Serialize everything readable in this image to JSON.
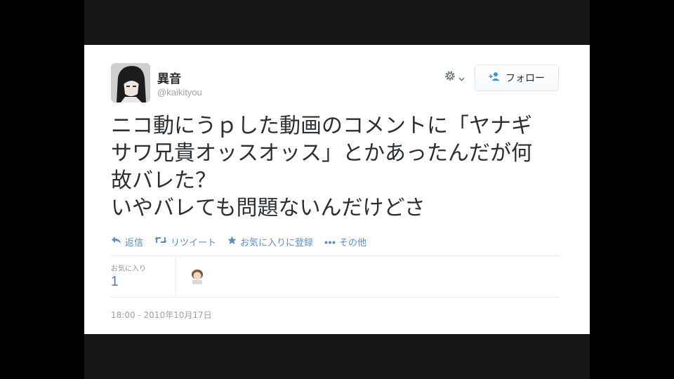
{
  "tweet": {
    "display_name": "異音",
    "handle": "@kaikityou",
    "follow_label": "フォロー",
    "text": "ニコ動にうｐした動画のコメントに「ヤナギ\nサワ兄貴オッスオッス」とかあったんだが何\n故バレた？\nいやバレても問題ないんだけどさ",
    "actions": {
      "reply": "返信",
      "retweet": "リツイート",
      "favorite": "お気に入りに登録",
      "more": "その他"
    },
    "stats": {
      "favorites_label": "お気に入り",
      "favorites_count": "1"
    },
    "timestamp": "18:00 - 2010年10月17日"
  },
  "icons": {
    "gear": "gear-icon",
    "follow": "user-plus-icon",
    "reply": "reply-arrow-icon",
    "retweet": "retweet-icon",
    "favorite": "star-icon",
    "more": "more-dots-icon"
  },
  "colors": {
    "action_blue": "#5b8fc2",
    "text": "#292f33",
    "muted": "#9aa3ab"
  }
}
